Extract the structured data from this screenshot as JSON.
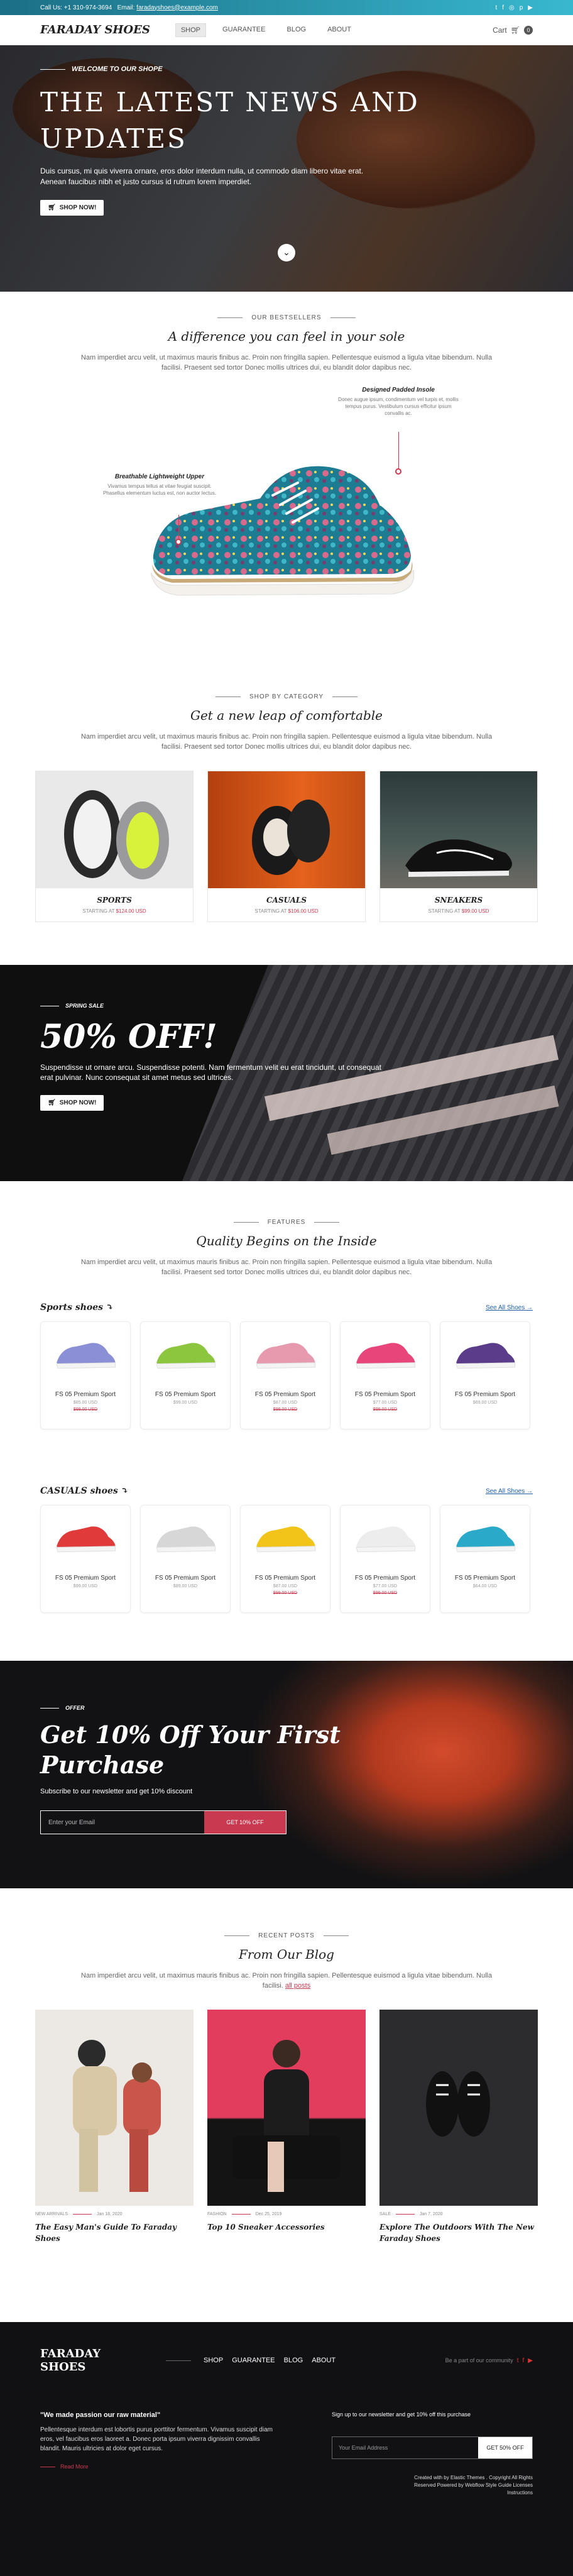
{
  "topbar": {
    "call": "Call Us: +1 310-974-3694",
    "email_label": "Email:",
    "email": "faradayshoes@example.com"
  },
  "nav": {
    "logo": "FARADAY SHOES",
    "items": [
      "SHOP",
      "GUARANTEE",
      "BLOG",
      "ABOUT"
    ],
    "active": "SHOP",
    "cart_label": "Cart",
    "cart_count": "0"
  },
  "hero": {
    "kicker": "WELCOME TO OUR SHOPE",
    "title": "THE LATEST NEWS AND UPDATES",
    "body": "Duis cursus, mi quis viverra ornare, eros dolor interdum nulla, ut commodo diam libero vitae erat. Aenean faucibus nibh et justo cursus id rutrum lorem imperdiet.",
    "button": "SHOP NOW!"
  },
  "bestsellers": {
    "eyebrow": "OUR BESTSELLERS",
    "title": "A difference you can feel in your sole",
    "lead": "Nam imperdiet arcu velit, ut maximus mauris finibus ac. Proin non fringilla sapien. Pellentesque euismod a ligula vitae bibendum. Nulla facilisi. Praesent sed tortor Donec mollis ultrices dui, eu blandit dolor dapibus nec.",
    "callout_right_title": "Designed Padded Insole",
    "callout_right_text": "Donec augue ipsum, condimentum vel turpis et, mollis tempus purus. Vestibulum cursus efficitur ipsum convallis ac.",
    "callout_left_title": "Breathable Lightweight Upper",
    "callout_left_text": "Vivamus tempus tellus at vitae feugiat suscipit. Phasellus elementum luctus est, non auctor lectus."
  },
  "categories": {
    "eyebrow": "SHOP BY CATEGORY",
    "title": "Get a new leap of comfortable",
    "lead": "Nam imperdiet arcu velit, ut maximus mauris finibus ac. Proin non fringilla sapien. Pellentesque euismod a ligula vitae bibendum. Nulla facilisi. Praesent sed tortor Donec mollis ultrices dui, eu blandit dolor dapibus nec.",
    "items": [
      {
        "name": "SPORTS",
        "price_prefix": "STARTING AT",
        "price": "$124.00 USD"
      },
      {
        "name": "CASUALS",
        "price_prefix": "STARTING AT",
        "price": "$106.00 USD"
      },
      {
        "name": "SNEAKERS",
        "price_prefix": "STARTING AT",
        "price": "$99.00 USD"
      }
    ]
  },
  "promo": {
    "kicker": "SPRING SALE",
    "title": "50% OFF!",
    "body": "Suspendisse ut ornare arcu. Suspendisse potenti. Nam fermentum velit eu erat tincidunt, ut consequat erat pulvinar. Nunc consequat sit amet metus sed ultrices.",
    "button": "SHOP NOW!"
  },
  "features": {
    "eyebrow": "FEATURES",
    "title": "Quality Begins on the Inside",
    "lead": "Nam imperdiet arcu velit, ut maximus mauris finibus ac. Proin non fringilla sapien. Pellentesque euismod a ligula vitae bibendum. Nulla facilisi. Praesent sed tortor Donec mollis ultrices dui, eu blandit dolor dapibus nec."
  },
  "sports": {
    "title": "Sports shoes",
    "link": "See All Shoes",
    "items": [
      {
        "name": "FS 05 Premium Sport",
        "price": "$85.00 USD",
        "old": "$99.00 USD",
        "color": "#8a8fd6"
      },
      {
        "name": "FS 05 Premium Sport",
        "price": "$99.00 USD",
        "old": "",
        "color": "#8cc63f"
      },
      {
        "name": "FS 05 Premium Sport",
        "price": "$87.00 USD",
        "old": "$99.00 USD",
        "color": "#e79aae"
      },
      {
        "name": "FS 05 Premium Sport",
        "price": "$77.00 USD",
        "old": "$99.00 USD",
        "color": "#e8467a"
      },
      {
        "name": "FS 05 Premium Sport",
        "price": "$69.00 USD",
        "old": "",
        "color": "#5b3c8a"
      }
    ]
  },
  "casuals": {
    "title": "CASUALS shoes",
    "link": "See All Shoes",
    "items": [
      {
        "name": "FS 05 Premium Sport",
        "price": "$99.00 USD",
        "old": "",
        "color": "#e03a3a"
      },
      {
        "name": "FS 05 Premium Sport",
        "price": "$89.00 USD",
        "old": "",
        "color": "#d7d7d7"
      },
      {
        "name": "FS 05 Premium Sport",
        "price": "$87.00 USD",
        "old": "$99.00 USD",
        "color": "#f2c318"
      },
      {
        "name": "FS 05 Premium Sport",
        "price": "$77.00 USD",
        "old": "$99.00 USD",
        "color": "#ededed"
      },
      {
        "name": "FS 05 Premium Sport",
        "price": "$64.00 USD",
        "old": "",
        "color": "#2aa9c9"
      }
    ]
  },
  "newsletter": {
    "kicker": "OFFER",
    "title": "Get 10% Off Your First Purchase",
    "body": "Subscribe to our newsletter and get 10% discount",
    "placeholder": "Enter your Email",
    "button": "GET 10% OFF"
  },
  "blog": {
    "eyebrow": "RECENT POSTS",
    "title": "From Our Blog",
    "lead": "Nam imperdiet arcu velit, ut maximus mauris finibus ac. Proin non fringilla sapien. Pellentesque euismod a ligula vitae bibendum. Nulla facilisi.",
    "lead_link": "all posts",
    "posts": [
      {
        "category": "NEW ARRIVALS",
        "date": "Jan 18, 2020",
        "title": "The Easy Man's Guide To Faraday Shoes"
      },
      {
        "category": "FASHION",
        "date": "Dec 25, 2019",
        "title": "Top 10 Sneaker Accessories"
      },
      {
        "category": "SALE",
        "date": "Jan 7, 2020",
        "title": "Explore The Outdoors With The New Faraday Shoes"
      }
    ]
  },
  "footer": {
    "logo": "FARADAY SHOES",
    "menu": [
      "SHOP",
      "GUARANTEE",
      "BLOG",
      "ABOUT"
    ],
    "follow": "Be a part of our community",
    "quote_title": "\"We made passion our raw material\"",
    "quote_body": "Pellentesque interdum est lobortis purus porttitor fermentum. Vivamus suscipit diam eros, vel faucibus eros laoreet a. Donec porta ipsum viverra dignissim convallis blandit. Mauris ultricies at dolor eget cursus.",
    "read_more": "Read More",
    "signup_title": "Sign up to our newsletter and get 10% off this purchase",
    "signup_placeholder": "Your Email Address",
    "signup_button": "GET 50% OFF",
    "credits_line1": "Created with by Elastic Themes . Copyright All Rights",
    "credits_line2": "Reserved Powered by Webflow Style Guide Licenses",
    "credits_line3": "Instructions"
  },
  "colors": {
    "accent": "#c9394f",
    "topbar": "#2a9bb5",
    "dark": "#111113"
  }
}
